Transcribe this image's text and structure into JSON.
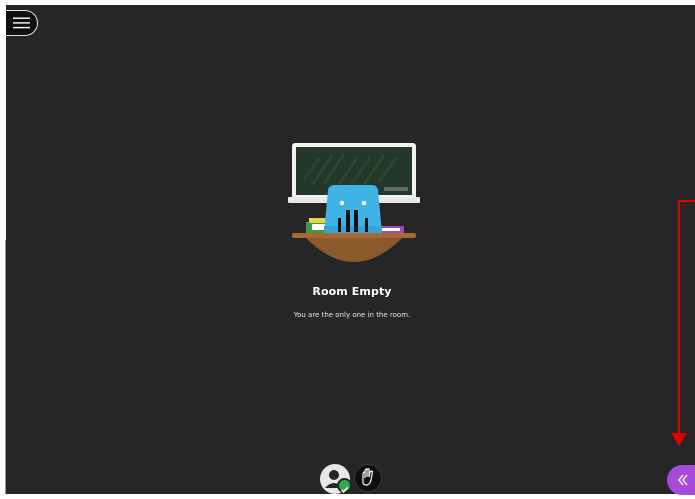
{
  "menu": {
    "icon": "hamburger-menu-icon"
  },
  "room": {
    "illustration": "empty-classroom-illustration",
    "title": "Room Empty",
    "subtitle": "You are the only one in the room."
  },
  "footer": {
    "avatar_icon": "user-avatar-icon",
    "status_icon": "check-icon",
    "hand_icon": "raise-hand-icon"
  },
  "collaborate_panel": {
    "icon": "double-chevron-left-icon"
  },
  "colors": {
    "stage_background": "#262626",
    "accent_purple": "#a64bd8",
    "status_green": "#2fa84f",
    "annotation_red": "#e00000"
  }
}
